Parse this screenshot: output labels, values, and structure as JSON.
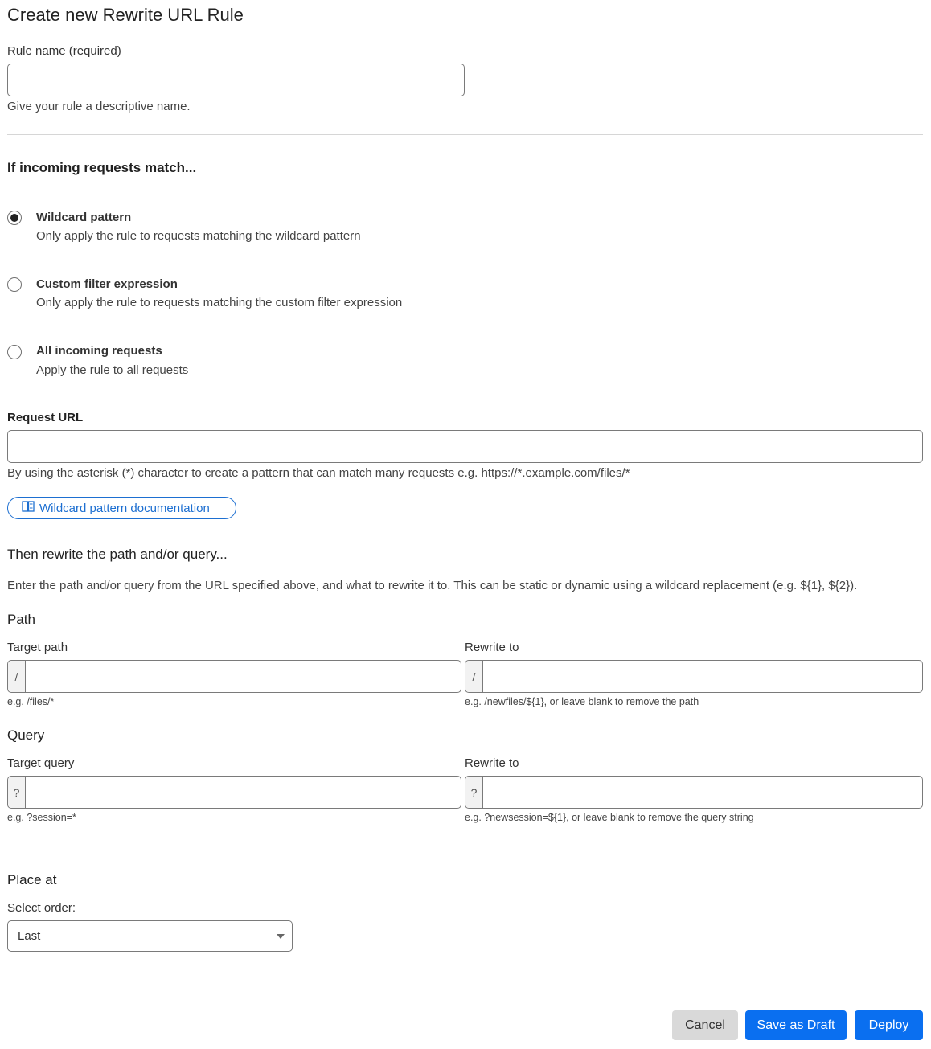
{
  "page": {
    "title": "Create new Rewrite URL Rule"
  },
  "rule_name": {
    "label": "Rule name (required)",
    "value": "",
    "help": "Give your rule a descriptive name."
  },
  "match": {
    "heading": "If incoming requests match...",
    "options": [
      {
        "title": "Wildcard pattern",
        "description": "Only apply the rule to requests matching the wildcard pattern",
        "selected": true
      },
      {
        "title": "Custom filter expression",
        "description": "Only apply the rule to requests matching the custom filter expression",
        "selected": false
      },
      {
        "title": "All incoming requests",
        "description": "Apply the rule to all requests",
        "selected": false
      }
    ]
  },
  "request_url": {
    "label": "Request URL",
    "value": "",
    "help": "By using the asterisk (*) character to create a pattern that can match many requests e.g. https://*.example.com/files/*",
    "doc_button": {
      "icon": "book-icon",
      "label": "Wildcard pattern documentation"
    }
  },
  "rewrite": {
    "heading": "Then rewrite the path and/or query...",
    "description": "Enter the path and/or query from the URL specified above, and what to rewrite it to. This can be static or dynamic using a wildcard replacement (e.g. ${1}, ${2}).",
    "path": {
      "heading": "Path",
      "target": {
        "label": "Target path",
        "prefix": "/",
        "value": "",
        "help": "e.g. /files/*"
      },
      "rewrite_to": {
        "label": "Rewrite to",
        "prefix": "/",
        "value": "",
        "help": "e.g. /newfiles/${1}, or leave blank to remove the path"
      }
    },
    "query": {
      "heading": "Query",
      "target": {
        "label": "Target query",
        "prefix": "?",
        "value": "",
        "help": "e.g. ?session=*"
      },
      "rewrite_to": {
        "label": "Rewrite to",
        "prefix": "?",
        "value": "",
        "help": "e.g. ?newsession=${1}, or leave blank to remove the query string"
      }
    }
  },
  "place_at": {
    "heading": "Place at",
    "label": "Select order:",
    "selected": "Last"
  },
  "actions": {
    "cancel": "Cancel",
    "save_draft": "Save as Draft",
    "deploy": "Deploy"
  },
  "colors": {
    "primary": "#0a6ff0",
    "link": "#1d6fd1",
    "cancel_bg": "#d9d9d9"
  }
}
